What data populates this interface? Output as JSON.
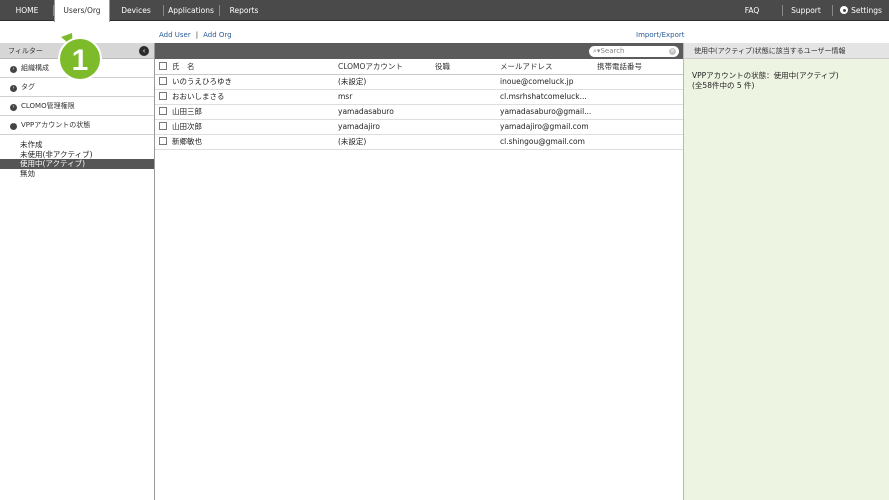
{
  "nav": {
    "home": "HOME",
    "users_org": "Users/Org",
    "devices": "Devices",
    "applications": "Applications",
    "reports": "Reports",
    "faq": "FAQ",
    "support": "Support",
    "settings": "Settings"
  },
  "callout_number": "1",
  "sublinks": {
    "add_user": "Add User",
    "separator": "|",
    "add_org": "Add Org",
    "import_export": "Import/Export"
  },
  "sidebar": {
    "header": "フィルター",
    "collapse_glyph": "‹",
    "groups": [
      {
        "label": "組織構成",
        "glyph": "›"
      },
      {
        "label": "タグ",
        "glyph": "›"
      },
      {
        "label": "CLOMO管理権限",
        "glyph": "›"
      },
      {
        "label": "VPPアカウントの状態",
        "glyph": "ˇ"
      }
    ],
    "options": [
      "未作成",
      "未使用(非アクティブ)",
      "使用中(アクティブ)",
      "無効"
    ]
  },
  "search": {
    "placeholder": "Search",
    "icon_glyph": "⌕▾",
    "clear_glyph": "×"
  },
  "table": {
    "headers": {
      "name": "氏　名",
      "account": "CLOMOアカウント",
      "role": "役職",
      "email": "メールアドレス",
      "phone": "携帯電話番号"
    },
    "rows": [
      {
        "name": "いのうえひろゆき",
        "account": "(未設定)",
        "role": "",
        "email": "inoue@comeluck.jp",
        "phone": ""
      },
      {
        "name": "おおいしまさる",
        "account": "msr",
        "role": "",
        "email": "cl.msrhshatcomeluck...",
        "phone": ""
      },
      {
        "name": "山田三郎",
        "account": "yamadasaburo",
        "role": "",
        "email": "yamadasaburo@gmail...",
        "phone": ""
      },
      {
        "name": "山田次郎",
        "account": "yamadajiro",
        "role": "",
        "email": "yamadajiro@gmail.com",
        "phone": ""
      },
      {
        "name": "新郷敏也",
        "account": "(未設定)",
        "role": "",
        "email": "cl.shingou@gmail.com",
        "phone": ""
      }
    ]
  },
  "right_panel": {
    "header": "使用中(アクティブ)状態に該当するユーザー情報",
    "line1": "VPPアカウントの状態：使用中(アクティブ)",
    "line2": "(全58件中の 5 件)"
  },
  "colors": {
    "nav_bg": "#4a4a4a",
    "link": "#2a5d9a",
    "callout_green": "#7dbb2b",
    "right_panel_bg": "#eef4e2"
  }
}
